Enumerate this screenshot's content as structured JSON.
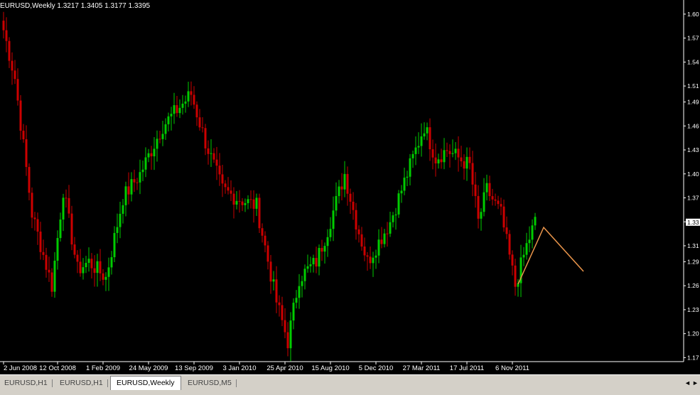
{
  "chart_title": "EURUSD,Weekly  1.3217 1.3405 1.3177 1.3395",
  "current_price_label": "1.33",
  "tabs": [
    {
      "label": "EURUSD,H1",
      "active": false
    },
    {
      "label": "EURUSD,H1",
      "active": false
    },
    {
      "label": "EURUSD,Weekly",
      "active": true
    },
    {
      "label": "EURUSD,M5",
      "active": false
    }
  ],
  "scroll_left_glyph": "◄",
  "scroll_right_glyph": "►",
  "colors": {
    "up": "#00cc00",
    "down": "#cc0000",
    "projection": "#e8944a",
    "axis": "#ffffff",
    "background": "#000000"
  },
  "chart_data": {
    "type": "candlestick",
    "symbol": "EURUSD",
    "timeframe": "Weekly",
    "ohlc_header": {
      "open": 1.3217,
      "high": 1.3405,
      "low": 1.3177,
      "close": 1.3395
    },
    "ylim": [
      1.165,
      1.615
    ],
    "y_ticks": [
      1.6,
      1.57,
      1.54,
      1.51,
      1.49,
      1.46,
      1.43,
      1.4,
      1.37,
      1.34,
      1.31,
      1.29,
      1.26,
      1.23,
      1.2,
      1.17
    ],
    "x_tick_labels": [
      "2 Jun 2008",
      "12 Oct 2008",
      "1 Feb 2009",
      "24 May 2009",
      "13 Sep 2009",
      "3 Jan 2010",
      "25 Apr 2010",
      "15 Aug 2010",
      "5 Dec 2010",
      "27 Mar 2011",
      "17 Jul 2011",
      "6 Nov 2011"
    ],
    "x_tick_bar_index": [
      0,
      19,
      35,
      51,
      67,
      83,
      99,
      115,
      131,
      147,
      163,
      179
    ],
    "bars_per_label": 16,
    "close_anchors": [
      [
        0,
        1.58
      ],
      [
        4,
        1.52
      ],
      [
        10,
        1.35
      ],
      [
        17,
        1.26
      ],
      [
        21,
        1.38
      ],
      [
        26,
        1.28
      ],
      [
        30,
        1.29
      ],
      [
        36,
        1.27
      ],
      [
        42,
        1.37
      ],
      [
        48,
        1.4
      ],
      [
        56,
        1.46
      ],
      [
        66,
        1.5
      ],
      [
        71,
        1.44
      ],
      [
        77,
        1.38
      ],
      [
        82,
        1.37
      ],
      [
        89,
        1.36
      ],
      [
        96,
        1.24
      ],
      [
        100,
        1.19
      ],
      [
        104,
        1.27
      ],
      [
        110,
        1.29
      ],
      [
        114,
        1.33
      ],
      [
        120,
        1.4
      ],
      [
        124,
        1.34
      ],
      [
        128,
        1.29
      ],
      [
        136,
        1.34
      ],
      [
        140,
        1.38
      ],
      [
        148,
        1.46
      ],
      [
        152,
        1.42
      ],
      [
        156,
        1.43
      ],
      [
        160,
        1.42
      ],
      [
        164,
        1.41
      ],
      [
        167,
        1.34
      ],
      [
        170,
        1.38
      ],
      [
        175,
        1.35
      ],
      [
        180,
        1.26
      ],
      [
        184,
        1.31
      ],
      [
        187,
        1.34
      ]
    ],
    "projection_line": [
      {
        "bar": 181,
        "price": 1.262
      },
      {
        "bar": 190,
        "price": 1.333
      },
      {
        "bar": 204,
        "price": 1.278
      }
    ]
  }
}
